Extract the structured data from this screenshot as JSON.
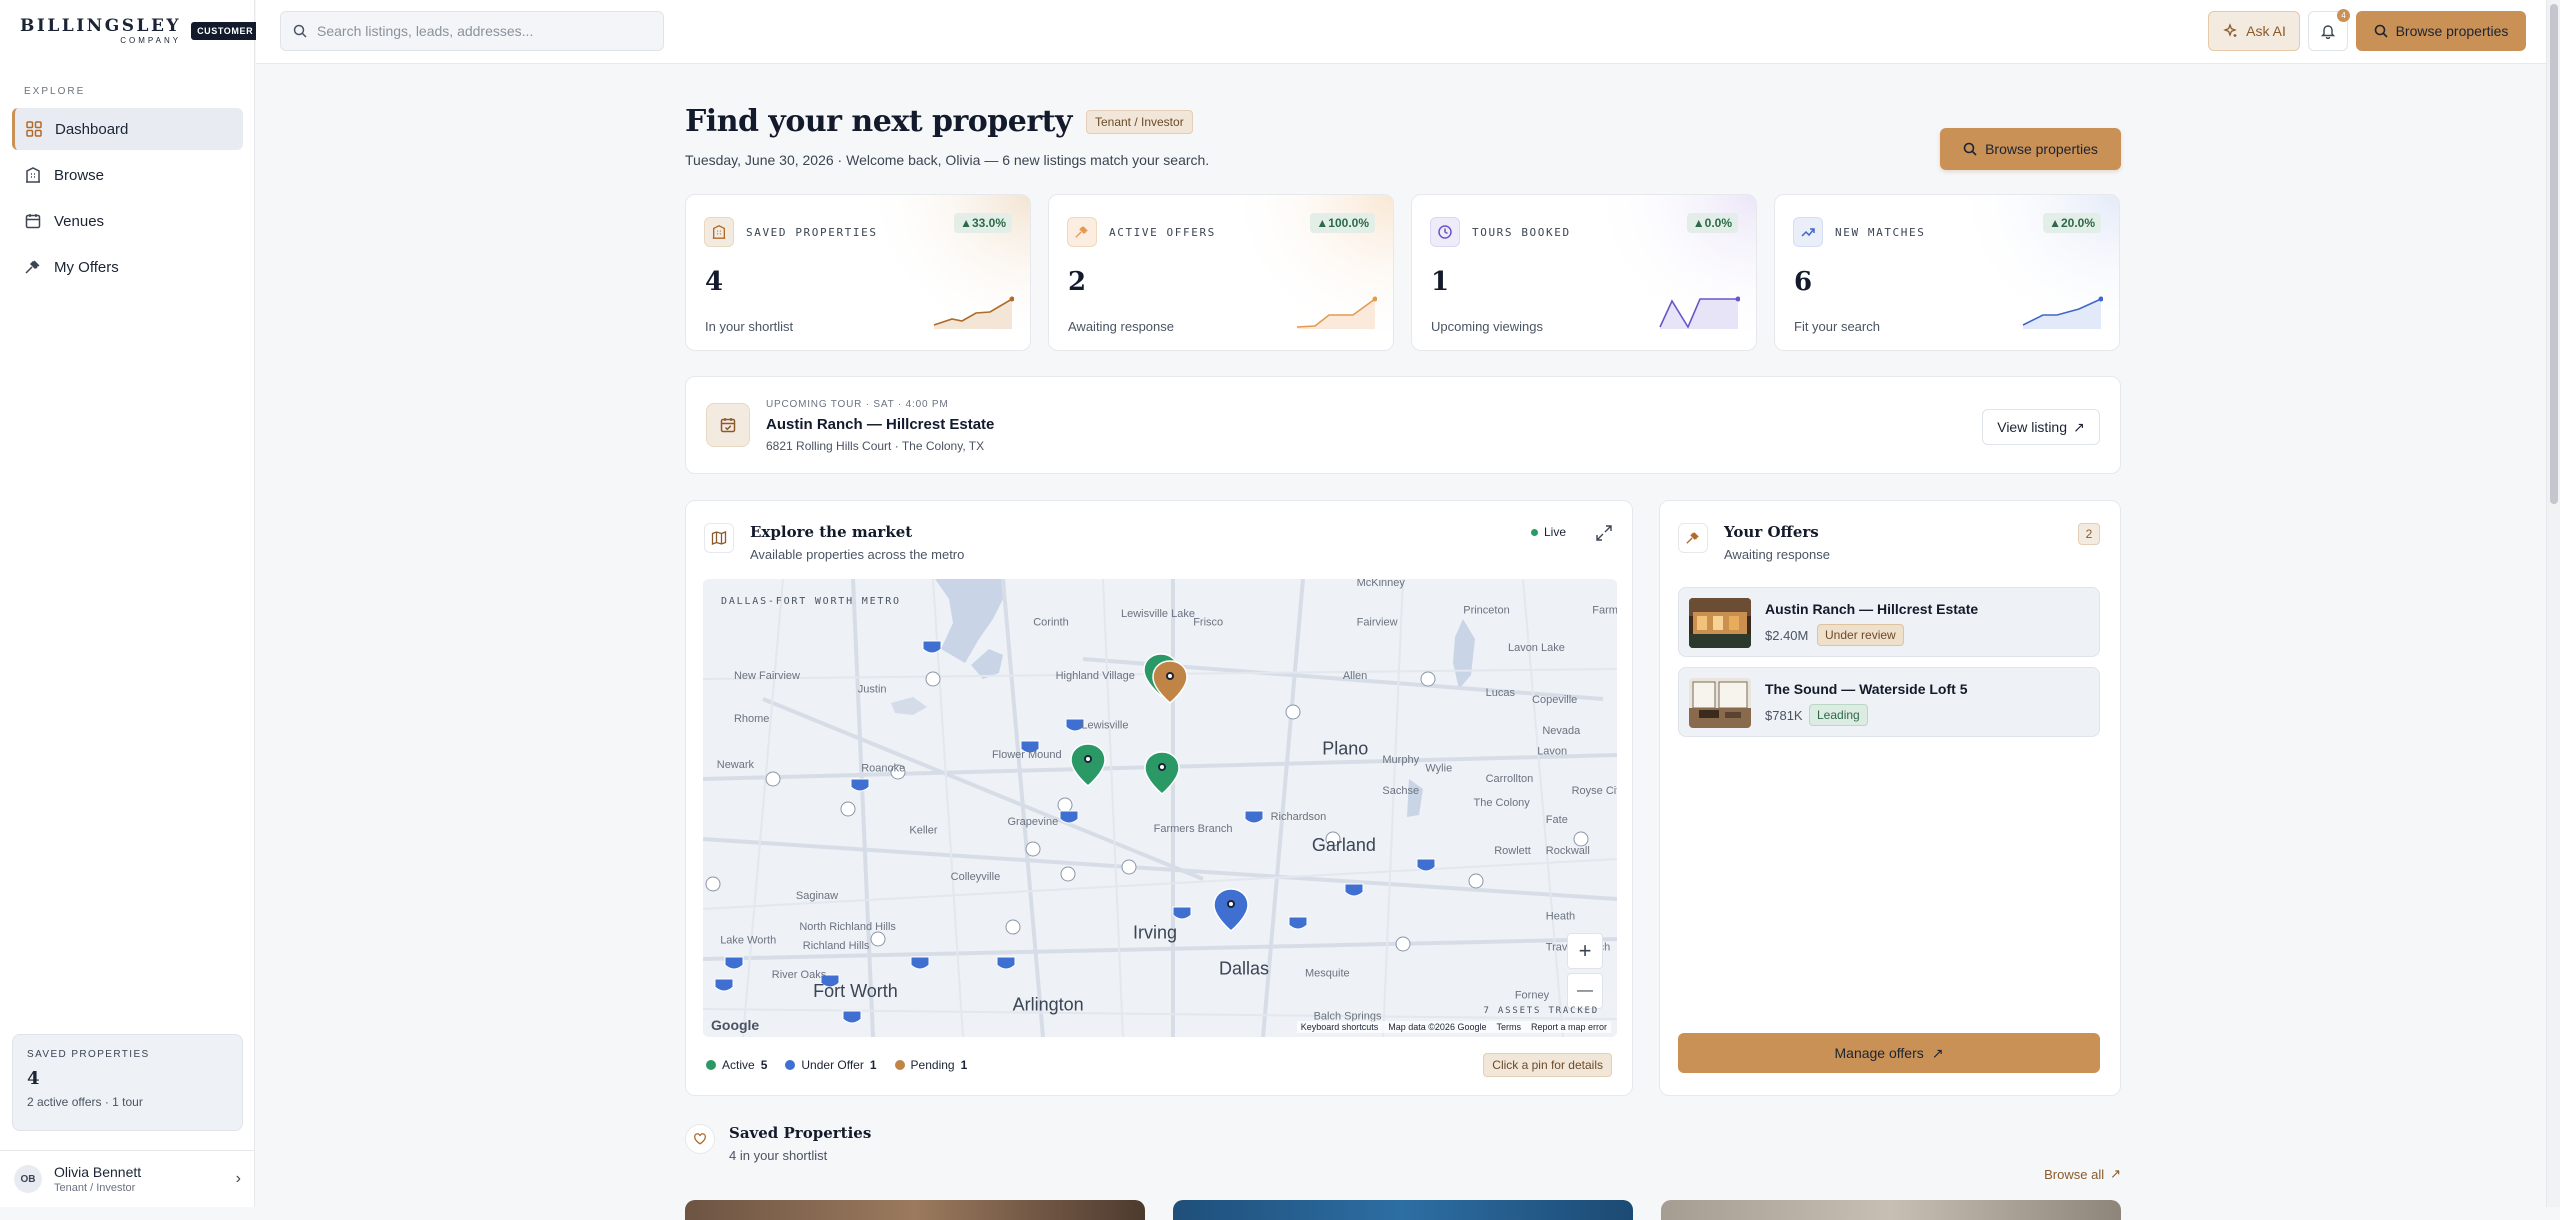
{
  "brand": {
    "name": "BILLINGSLEY",
    "sub": "COMPANY",
    "badge": "CUSTOMER"
  },
  "sidebar": {
    "section_label": "EXPLORE",
    "items": [
      {
        "label": "Dashboard",
        "icon": "dashboard-grid-icon",
        "active": true
      },
      {
        "label": "Browse",
        "icon": "building-icon",
        "active": false
      },
      {
        "label": "Venues",
        "icon": "calendar-icon",
        "active": false
      },
      {
        "label": "My Offers",
        "icon": "gavel-icon",
        "active": false
      }
    ],
    "saved": {
      "label": "SAVED PROPERTIES",
      "value": "4",
      "sub": "2 active offers · 1 tour"
    },
    "user": {
      "initials": "OB",
      "name": "Olivia Bennett",
      "role": "Tenant / Investor"
    }
  },
  "topbar": {
    "search_placeholder": "Search listings, leads, addresses...",
    "ask_ai": "Ask AI",
    "notification_count": "4",
    "browse": "Browse properties"
  },
  "header": {
    "title": "Find your next property",
    "role_chip": "Tenant / Investor",
    "subtitle": "Tuesday, June 30, 2026 · Welcome back, Olivia — 6 new listings match your search.",
    "browse": "Browse properties"
  },
  "stats": [
    {
      "label": "SAVED PROPERTIES",
      "delta": "▲33.0%",
      "value": "4",
      "sub": "In your shortlist",
      "color": "#b06a2c",
      "icon": "building-icon"
    },
    {
      "label": "ACTIVE OFFERS",
      "delta": "▲100.0%",
      "value": "2",
      "sub": "Awaiting response",
      "color": "#e39a4f",
      "icon": "gavel-icon"
    },
    {
      "label": "TOURS BOOKED",
      "delta": "▲0.0%",
      "value": "1",
      "sub": "Upcoming viewings",
      "color": "#6b55c8",
      "icon": "clock-icon"
    },
    {
      "label": "NEW MATCHES",
      "delta": "▲20.0%",
      "value": "6",
      "sub": "Fit your search",
      "color": "#3f67c9",
      "icon": "trend-up-icon"
    }
  ],
  "tour": {
    "kicker": "UPCOMING TOUR · SAT · 4:00 PM",
    "title": "Austin Ranch — Hillcrest Estate",
    "address": "6821 Rolling Hills Court · The Colony, TX",
    "button": "View listing"
  },
  "map_card": {
    "title": "Explore the market",
    "sub": "Available properties across the metro",
    "live": "Live",
    "map_label": "DALLAS-FORT WORTH METRO",
    "assets": "7 ASSETS TRACKED",
    "attribution": [
      "Keyboard shortcuts",
      "Map data ©2026 Google",
      "Terms",
      "Report a map error"
    ],
    "google": "Google",
    "legend": [
      {
        "label": "Active",
        "count": "5",
        "color": "#2a9966"
      },
      {
        "label": "Under Offer",
        "count": "1",
        "color": "#3f6fd1"
      },
      {
        "label": "Pending",
        "count": "1",
        "color": "#c08447"
      }
    ],
    "hint": "Click a pin for details",
    "places": [
      {
        "name": "McKinney",
        "big": false
      },
      {
        "name": "Princeton",
        "big": false
      },
      {
        "name": "Farmersville",
        "big": false
      },
      {
        "name": "Corinth",
        "big": false
      },
      {
        "name": "Frisco",
        "big": false
      },
      {
        "name": "Fairview",
        "big": false
      },
      {
        "name": "New Fairview",
        "big": false
      },
      {
        "name": "Justin",
        "big": false
      },
      {
        "name": "Highland Village",
        "big": false
      },
      {
        "name": "Allen",
        "big": false
      },
      {
        "name": "Lucas",
        "big": false
      },
      {
        "name": "Copeville",
        "big": false
      },
      {
        "name": "Rhome",
        "big": false
      },
      {
        "name": "Lewisville",
        "big": false
      },
      {
        "name": "Lavon Lake",
        "big": false
      },
      {
        "name": "Nevada",
        "big": false
      },
      {
        "name": "Lavon",
        "big": false
      },
      {
        "name": "Plano",
        "big": true
      },
      {
        "name": "Murphy",
        "big": false
      },
      {
        "name": "Wylie",
        "big": false
      },
      {
        "name": "Newark",
        "big": false
      },
      {
        "name": "Roanoke",
        "big": false
      },
      {
        "name": "Flower Mound",
        "big": false
      },
      {
        "name": "Sachse",
        "big": false
      },
      {
        "name": "Royse City",
        "big": false
      },
      {
        "name": "Keller",
        "big": false
      },
      {
        "name": "Grapevine",
        "big": false
      },
      {
        "name": "Farmers Branch",
        "big": false
      },
      {
        "name": "Richardson",
        "big": false
      },
      {
        "name": "Fate",
        "big": false
      },
      {
        "name": "Garland",
        "big": true
      },
      {
        "name": "Rowlett",
        "big": false
      },
      {
        "name": "Rockwall",
        "big": false
      },
      {
        "name": "Colleyville",
        "big": false
      },
      {
        "name": "Saginaw",
        "big": false
      },
      {
        "name": "North Richland Hills",
        "big": false
      },
      {
        "name": "Richland Hills",
        "big": false
      },
      {
        "name": "Irving",
        "big": true
      },
      {
        "name": "Heath",
        "big": false
      },
      {
        "name": "Lake Worth",
        "big": false
      },
      {
        "name": "Dallas",
        "big": true
      },
      {
        "name": "River Oaks",
        "big": false
      },
      {
        "name": "Fort Worth",
        "big": true
      },
      {
        "name": "Arlington",
        "big": true
      },
      {
        "name": "Mesquite",
        "big": false
      },
      {
        "name": "Travis Ranch",
        "big": false
      },
      {
        "name": "Forney",
        "big": false
      },
      {
        "name": "Balch Springs",
        "big": false
      },
      {
        "name": "Lewisville Lake",
        "big": false
      },
      {
        "name": "The Colony",
        "big": false
      },
      {
        "name": "Carrollton",
        "big": false
      }
    ],
    "zoom_in": "+",
    "zoom_out": "—"
  },
  "offers": {
    "title": "Your Offers",
    "sub": "Awaiting response",
    "count": "2",
    "items": [
      {
        "name": "Austin Ranch — Hillcrest Estate",
        "price": "$2.40M",
        "status": "Under review"
      },
      {
        "name": "The Sound — Waterside Loft 5",
        "price": "$781K",
        "status": "Leading"
      }
    ],
    "manage": "Manage offers"
  },
  "saved_section": {
    "title": "Saved Properties",
    "sub": "4 in your shortlist",
    "browse_all": "Browse all"
  }
}
